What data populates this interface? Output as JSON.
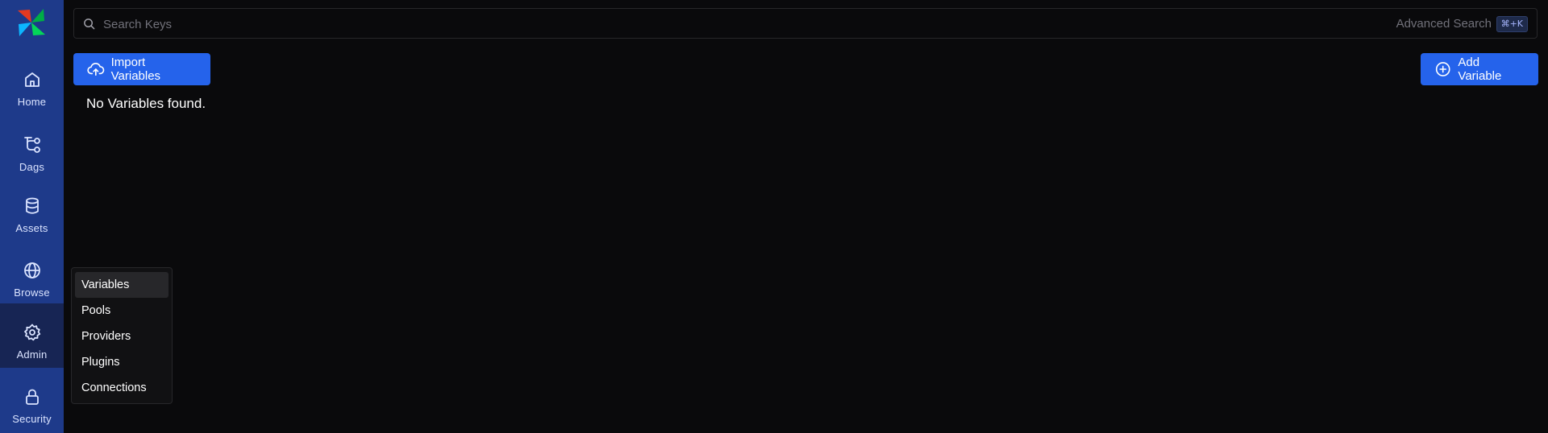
{
  "sidebar": {
    "items": [
      {
        "label": "Home",
        "icon": "home-icon"
      },
      {
        "label": "Dags",
        "icon": "dags-icon"
      },
      {
        "label": "Assets",
        "icon": "database-icon"
      },
      {
        "label": "Browse",
        "icon": "globe-icon"
      },
      {
        "label": "Admin",
        "icon": "gear-icon",
        "active": true
      },
      {
        "label": "Security",
        "icon": "lock-icon"
      }
    ]
  },
  "search": {
    "placeholder": "Search Keys",
    "value": "",
    "advanced_label": "Advanced Search",
    "shortcut": "⌘+K"
  },
  "toolbar": {
    "import_label": "Import Variables",
    "add_label": "Add Variable"
  },
  "main": {
    "empty_message": "No Variables found."
  },
  "admin_menu": {
    "items": [
      "Variables",
      "Pools",
      "Providers",
      "Plugins",
      "Connections"
    ],
    "selected": "Variables"
  },
  "colors": {
    "sidebar": "#1e3a8a",
    "sidebar_active": "#172554",
    "accent": "#2563eb",
    "background": "#0a0a0c"
  }
}
